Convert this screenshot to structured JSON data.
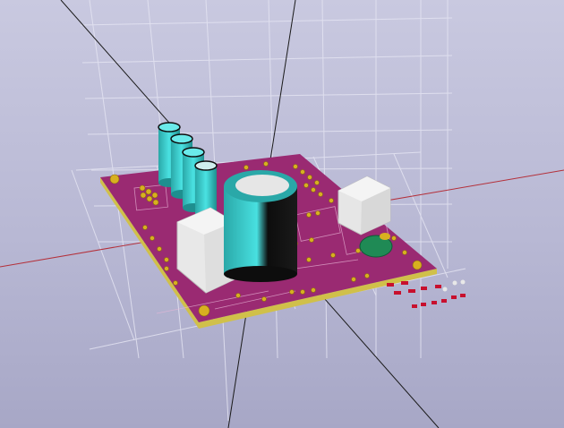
{
  "window": {
    "view": "3D Viewer"
  },
  "scene": {
    "background_top": "#c9c9e0",
    "background_bottom": "#a7a7c6",
    "grid_color": "#e4e4f2",
    "axis_x_color": "#b4303a",
    "axis_y_color": "#1a1a1a",
    "pcb_color": "#9a2a72",
    "pcb_edge_color": "#d0c04a",
    "copper_color": "#d8b020",
    "capacitor_color": "#3ccfcf",
    "capacitor_dark": "#0e0e0e",
    "relay_color": "#efefef",
    "diode_color": "#1f8a55",
    "smd_pad_color": "#c8102e",
    "silkscreen_labels": [
      "",
      "",
      "",
      ""
    ]
  }
}
